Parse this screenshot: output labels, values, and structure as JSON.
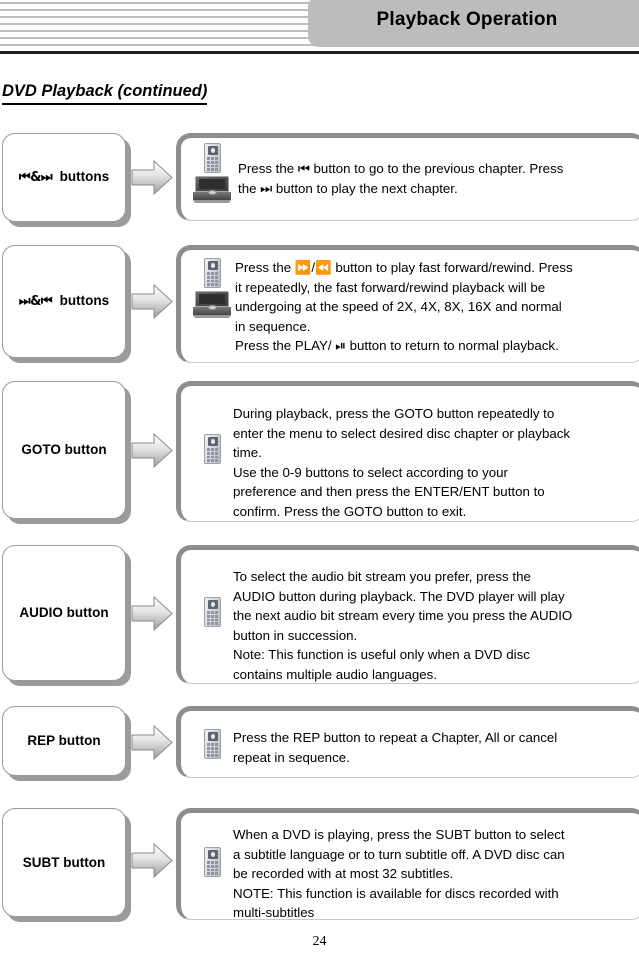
{
  "header": {
    "title": "Playback Operation",
    "tab_color": "#bcbcbc",
    "rule_color": "#231f20",
    "stripe_color": "#bfbfbf"
  },
  "section": {
    "title": "DVD Playback (continued)"
  },
  "rows": [
    {
      "id": "prev-next-chapter",
      "label_prefix": "",
      "label_glyph_left": "⏮⏭",
      "label": "⏮&⏭  buttons",
      "icons": [
        "remote-control-icon",
        "dvd-player-icon"
      ],
      "lines": [
        "Press the ⏮ button to go to the previous chapter. Press",
        "the ⏭ button to play the next chapter."
      ]
    },
    {
      "id": "fast-forward-rewind",
      "label": "⏩&⏪  buttons",
      "icons": [
        "remote-control-icon",
        "dvd-player-icon"
      ],
      "lines": [
        "Press the ⏩/⏪ button to play fast forward/rewind. Press",
        "it repeatedly, the fast forward/rewind playback will be",
        "undergoing at the speed of 2X, 4X, 8X, 16X and normal",
        "in sequence.",
        "Press the PLAY/ ⏯ button to return to normal playback."
      ]
    },
    {
      "id": "goto",
      "label": "GOTO button",
      "icons": [
        "remote-control-icon"
      ],
      "lines": [
        "During playback, press the GOTO button repeatedly to",
        "enter the menu to select desired disc chapter or playback",
        "time.",
        "Use the 0-9 buttons to select according to your",
        "preference and then press the ENTER/ENT button to",
        "confirm. Press the GOTO button to exit."
      ]
    },
    {
      "id": "audio",
      "label": "AUDIO button",
      "icons": [
        "remote-control-icon"
      ],
      "lines": [
        "To select the audio bit stream you prefer, press the",
        "AUDIO button during playback. The DVD player will play",
        "the next audio bit stream every time you press the AUDIO",
        "button in succession.",
        "Note: This function is useful only when a DVD disc",
        "contains multiple audio languages."
      ]
    },
    {
      "id": "rep",
      "label": "REP button",
      "icons": [
        "remote-control-icon"
      ],
      "lines": [
        "Press the REP button to repeat a Chapter, All or cancel",
        "repeat in sequence."
      ]
    },
    {
      "id": "subt",
      "label": "SUBT button",
      "icons": [
        "remote-control-icon"
      ],
      "lines": [
        "When a DVD is playing, press the SUBT button to select",
        "a subtitle language or to turn subtitle off. A DVD disc can",
        "be recorded with at most 32 subtitles.",
        "NOTE: This function is available for discs recorded with",
        "multi-subtitles"
      ]
    }
  ],
  "footer": {
    "page_number": "24"
  }
}
